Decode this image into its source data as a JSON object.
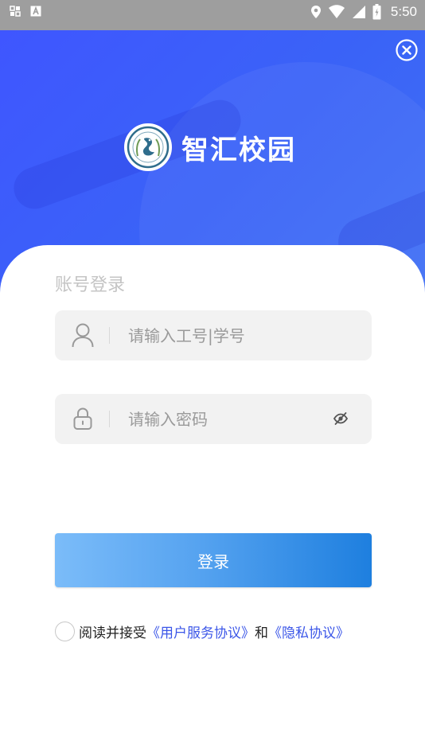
{
  "status_bar": {
    "time": "5:50",
    "icons": [
      "notification-grid-icon",
      "font-a-icon",
      "location-icon",
      "wifi-icon",
      "signal-icon",
      "battery-icon"
    ]
  },
  "hero": {
    "brand_title": "智汇校园",
    "close_icon": "close-circle-icon"
  },
  "login": {
    "heading": "账号登录",
    "account_placeholder": "请输入工号|学号",
    "account_value": "",
    "password_placeholder": "请输入密码",
    "password_value": "",
    "submit_label": "登录"
  },
  "agreement": {
    "prefix": "阅读并接受",
    "terms_link": "《用户服务协议》",
    "conjunction": "和",
    "privacy_link": "《隐私协议》",
    "checked": false
  },
  "colors": {
    "hero_blue": "#3f56ff",
    "link_blue": "#3b56e8",
    "button_start": "#7bbcf9",
    "button_end": "#1e7fdf",
    "field_bg": "#f2f2f2",
    "status_bar": "#9e9e9e"
  }
}
